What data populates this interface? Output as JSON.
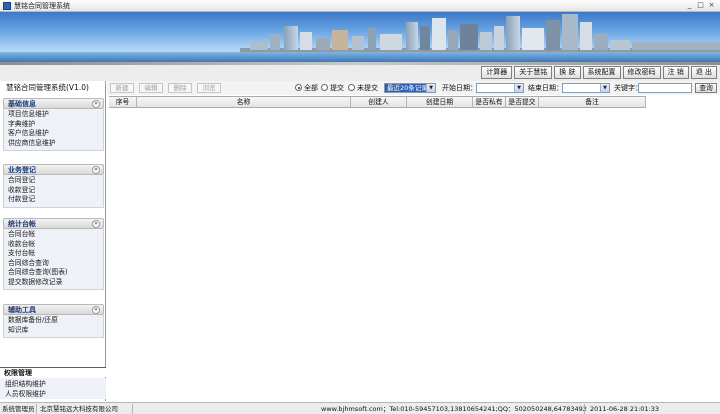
{
  "window": {
    "title": "慧铭合同管理系统",
    "controls": {
      "minimize": "_",
      "maximize": "□",
      "close": "×"
    }
  },
  "toolbar": {
    "buttons": [
      "计算器",
      "关于慧铭",
      "换 肤",
      "系统配置",
      "修改密码",
      "注 销",
      "退 出"
    ]
  },
  "sidebar": {
    "app_name": "慧铭合同管理系统(V1.0)",
    "toggle_symbol": "»",
    "sections": [
      {
        "title": "基础信息",
        "items": [
          "项目信息维护",
          "字典维护",
          "客户信息维护",
          "供应商信息维护"
        ]
      },
      {
        "title": "业务登记",
        "items": [
          "合同登记",
          "收款登记",
          "付款登记"
        ]
      },
      {
        "title": "统计台帐",
        "items": [
          "合同台帐",
          "收款台帐",
          "支付台帐",
          "合同综合查询",
          "合同综合查询(图表)",
          "提交数据修改记录"
        ]
      },
      {
        "title": "辅助工具",
        "items": [
          "数据库备份/还原",
          "知识库"
        ]
      }
    ],
    "permissions": {
      "title": "权限管理",
      "items": [
        "组织结构维护",
        "人员权限维护"
      ]
    }
  },
  "actions": {
    "buttons": [
      "新建",
      "编辑",
      "删除",
      "浏览"
    ],
    "filter": {
      "options": [
        "全部",
        "提交",
        "未提交"
      ],
      "selected": "全部",
      "record_count": "最近20条记录",
      "start_label": "开始日期：",
      "end_label": "结束日期：",
      "keyword_label": "关键字：",
      "keyword_value": "",
      "query_button": "查询"
    }
  },
  "grid": {
    "columns": [
      "序号",
      "名称",
      "创建人",
      "创建日期",
      "是否私有",
      "是否提交",
      "备注"
    ],
    "rows": []
  },
  "statusbar": {
    "user": "系统管理员",
    "company": "北京慧铭远大科技有限公司",
    "contact": "www.bjhmsoft.com；Tel:010-59457103,13810654241;QQ：502050248,64783492",
    "datetime": "2011-06-28 21:01:33"
  },
  "colors": {
    "accent": "#2f63b3",
    "section_title": "#1b3a78",
    "panel_bg": "#eef1f7"
  }
}
